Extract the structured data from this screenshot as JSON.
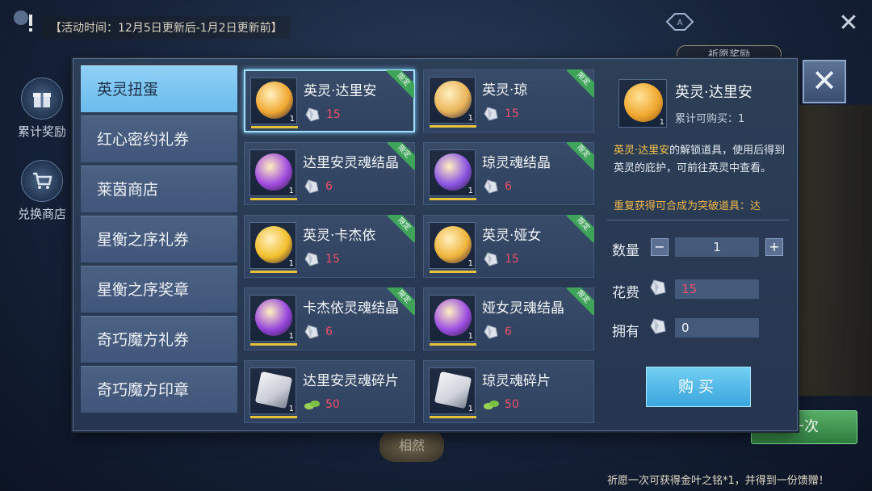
{
  "event_time": "【活动时间：12月5日更新后-1月2日更新前】",
  "background": {
    "side_buttons": [
      {
        "label": "累计奖励"
      },
      {
        "label": "兑换商店"
      }
    ],
    "pray_label": "祈愿奖励",
    "draw_button": "一次",
    "nameplate": "相然",
    "bottom_tip": "祈愿一次可获得金叶之铭*1，并得到一份馈赠！"
  },
  "categories": [
    "英灵扭蛋",
    "红心密约礼券",
    "莱茵商店",
    "星衡之序礼券",
    "星衡之序奖章",
    "奇巧魔方礼券",
    "奇巧魔方印章"
  ],
  "items": [
    {
      "name": "英灵·达里安",
      "price": "15",
      "qty": "1",
      "tag": "限定",
      "orb": "#f0a830",
      "cur": "crystal"
    },
    {
      "name": "英灵·琼",
      "price": "15",
      "qty": "1",
      "tag": "限定",
      "orb": "#e9b55a",
      "cur": "crystal"
    },
    {
      "name": "达里安灵魂结晶",
      "price": "6",
      "qty": "1",
      "tag": "限定",
      "orb": "#a24ce0",
      "cur": "crystal"
    },
    {
      "name": "琼灵魂结晶",
      "price": "6",
      "qty": "1",
      "tag": "限定",
      "orb": "#8c55e4",
      "cur": "crystal"
    },
    {
      "name": "英灵·卡杰依",
      "price": "15",
      "qty": "1",
      "tag": "限定",
      "orb": "#f2bf2c",
      "cur": "crystal"
    },
    {
      "name": "英灵·娅女",
      "price": "15",
      "qty": "1",
      "tag": "限定",
      "orb": "#f0b43a",
      "cur": "crystal"
    },
    {
      "name": "卡杰依灵魂结晶",
      "price": "6",
      "qty": "1",
      "tag": "限定",
      "orb": "#9746dd",
      "cur": "crystal"
    },
    {
      "name": "娅女灵魂结晶",
      "price": "6",
      "qty": "1",
      "tag": "限定",
      "orb": "#9d4fe2",
      "cur": "crystal"
    },
    {
      "name": "达里安灵魂碎片",
      "price": "50",
      "qty": "1",
      "tag": "",
      "orb": "#c9ccd6",
      "cur": "leaf"
    },
    {
      "name": "琼灵魂碎片",
      "price": "50",
      "qty": "1",
      "tag": "",
      "orb": "#d0d3dc",
      "cur": "leaf"
    }
  ],
  "detail": {
    "title": "英灵·达里安",
    "limit": "累计可购买：1",
    "desc_highlight": "英灵·达里安",
    "desc_rest": "的解锁道具，使用后得到英灵的庇护，可前往英灵中查看。",
    "warn": "重复获得可合成为突破道具：达",
    "qty_label": "数量",
    "qty_value": "1",
    "cost_label": "花费",
    "cost_value": "15",
    "own_label": "拥有",
    "own_value": "0",
    "buy_label": "购买",
    "thumb_qty": "1"
  },
  "colors": {
    "accent": "#6bbbed",
    "price": "#f0506a",
    "tag": "#3fa35a",
    "highlight": "#f3c34a"
  }
}
